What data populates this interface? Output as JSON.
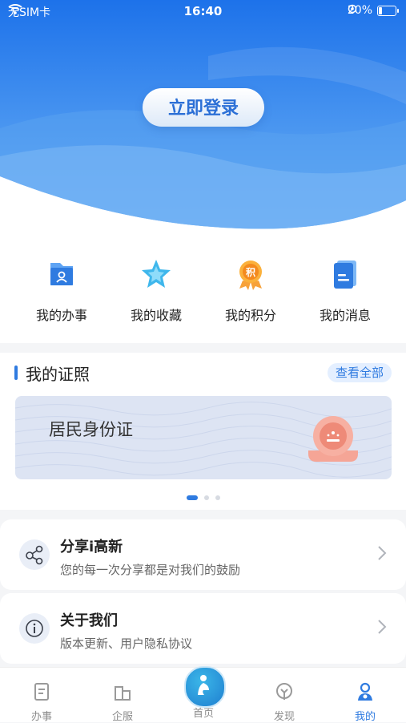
{
  "status_bar": {
    "carrier": "无SIM卡",
    "time": "16:40",
    "battery": "20%",
    "battery_level": 0.2
  },
  "login_button": "立即登录",
  "quick_actions": [
    {
      "label": "我的办事",
      "icon": "folder-user-icon"
    },
    {
      "label": "我的收藏",
      "icon": "star-icon"
    },
    {
      "label": "我的积分",
      "icon": "points-badge-icon"
    },
    {
      "label": "我的消息",
      "icon": "message-doc-icon"
    }
  ],
  "points_badge_char": "积",
  "certificates": {
    "title": "我的证照",
    "view_all": "查看全部",
    "card_name": "居民身份证",
    "page_count": 3,
    "active_page": 0
  },
  "menu": [
    {
      "title": "分享i高新",
      "subtitle": "您的每一次分享都是对我们的鼓励",
      "icon": "share-icon"
    },
    {
      "title": "关于我们",
      "subtitle": "版本更新、用户隐私协议",
      "icon": "info-icon"
    }
  ],
  "tab_bar": [
    {
      "label": "办事",
      "icon": "task-doc-icon"
    },
    {
      "label": "企服",
      "icon": "building-icon"
    },
    {
      "label": "首页",
      "icon": "home-figure-icon"
    },
    {
      "label": "发现",
      "icon": "discover-icon"
    },
    {
      "label": "我的",
      "icon": "profile-icon",
      "active": true
    }
  ],
  "colors": {
    "accent": "#2f7be0",
    "header_top": "#1e78ea",
    "header_wave": "#5aa6f2"
  }
}
